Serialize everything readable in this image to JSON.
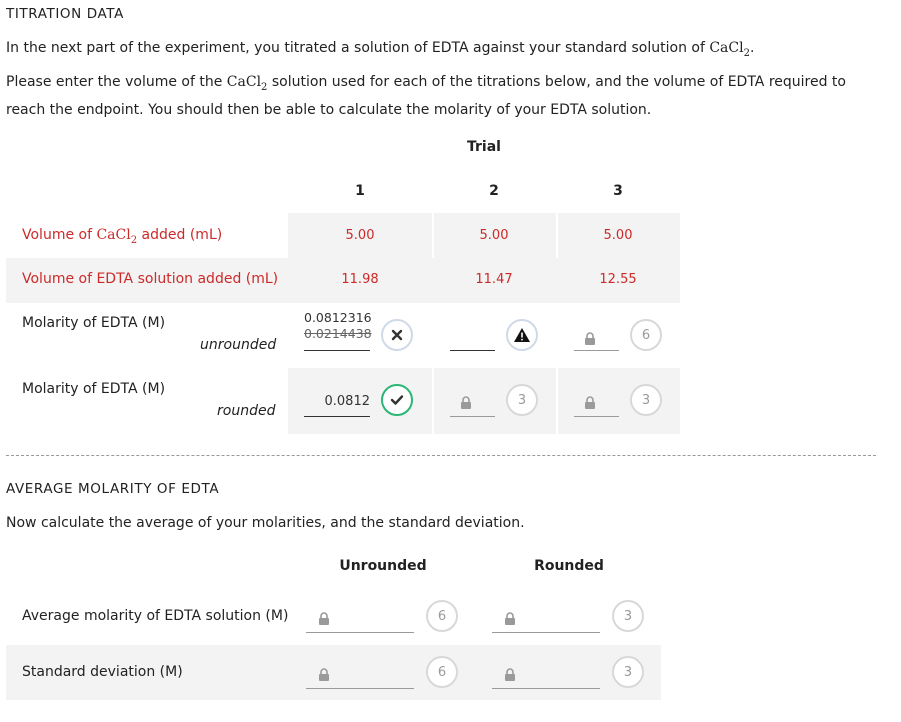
{
  "titration": {
    "title": "TITRATION DATA",
    "intro_text": "In the next part of the experiment, you titrated a solution of EDTA against your standard solution of",
    "intro_formula": "CaCl",
    "intro_formula_sub": "2",
    "intro_end": ".",
    "instr_1": "Please enter the volume of the",
    "instr_formula": "CaCl",
    "instr_formula_sub": "2",
    "instr_2": "solution used for each of the titrations below, and the volume of EDTA required to reach the endpoint. You should then be able to calculate the molarity of your EDTA solution.",
    "trial_header": "Trial",
    "trials": [
      "1",
      "2",
      "3"
    ],
    "row_vol_cacl2": {
      "prefix": "Volume of",
      "formula": "CaCl",
      "sub": "2",
      "suffix": "added (mL)",
      "values": [
        "5.00",
        "5.00",
        "5.00"
      ]
    },
    "row_vol_edta": {
      "label": "Volume of EDTA solution added (mL)",
      "values": [
        "11.98",
        "11.47",
        "12.55"
      ]
    },
    "row_molarity_unrounded": {
      "label": "Molarity of EDTA (M)",
      "sublabel": "unrounded",
      "trial1_value": "0.0812316",
      "trial1_previous": "0.0214438",
      "trial3_attempts": "6"
    },
    "row_molarity_rounded": {
      "label": "Molarity of EDTA (M)",
      "sublabel": "rounded",
      "trial1_value": "0.0812",
      "trial2_attempts": "3",
      "trial3_attempts": "3"
    }
  },
  "average": {
    "title": "AVERAGE MOLARITY OF EDTA",
    "intro": "Now calculate the average of your molarities, and the standard deviation.",
    "col_unrounded": "Unrounded",
    "col_rounded": "Rounded",
    "row_avg": {
      "label": "Average molarity of EDTA solution (M)",
      "unrounded_attempts": "6",
      "rounded_attempts": "3"
    },
    "row_std": {
      "label": "Standard deviation (M)",
      "unrounded_attempts": "6",
      "rounded_attempts": "3"
    }
  },
  "colors": {
    "error_label": "#cc2a2a",
    "correct": "#2bb673",
    "cell_bg": "#f3f3f3"
  }
}
